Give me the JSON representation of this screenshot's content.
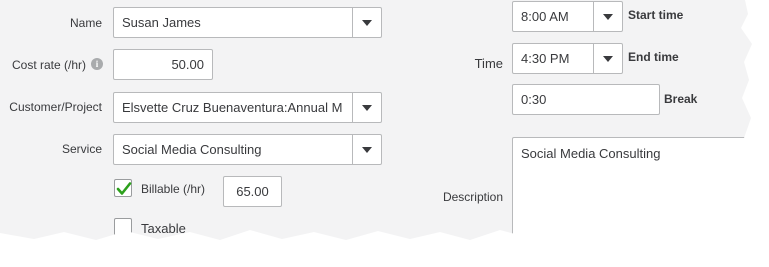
{
  "form": {
    "name": {
      "label": "Name",
      "value": "Susan James"
    },
    "cost_rate": {
      "label": "Cost rate (/hr)",
      "value": "50.00",
      "info_icon": "info-icon"
    },
    "customer_project": {
      "label": "Customer/Project",
      "value": "Elsvette Cruz Buenaventura:Annual M"
    },
    "service": {
      "label": "Service",
      "value": "Social Media Consulting"
    },
    "billable": {
      "label": "Billable (/hr)",
      "checked": true,
      "rate": "65.00"
    },
    "taxable": {
      "label": "Taxable",
      "checked": false
    },
    "time": {
      "label": "Time",
      "start": {
        "value": "8:00 AM",
        "label": "Start time"
      },
      "end": {
        "value": "4:30 PM",
        "label": "End time"
      },
      "break": {
        "value": "0:30",
        "label": "Break"
      }
    },
    "description": {
      "label": "Description",
      "value": "Social Media Consulting"
    }
  },
  "colors": {
    "text": "#393a3d",
    "checkmark": "#2ca01c",
    "border": "#b8b9bb",
    "background": "#f3f3f4"
  }
}
